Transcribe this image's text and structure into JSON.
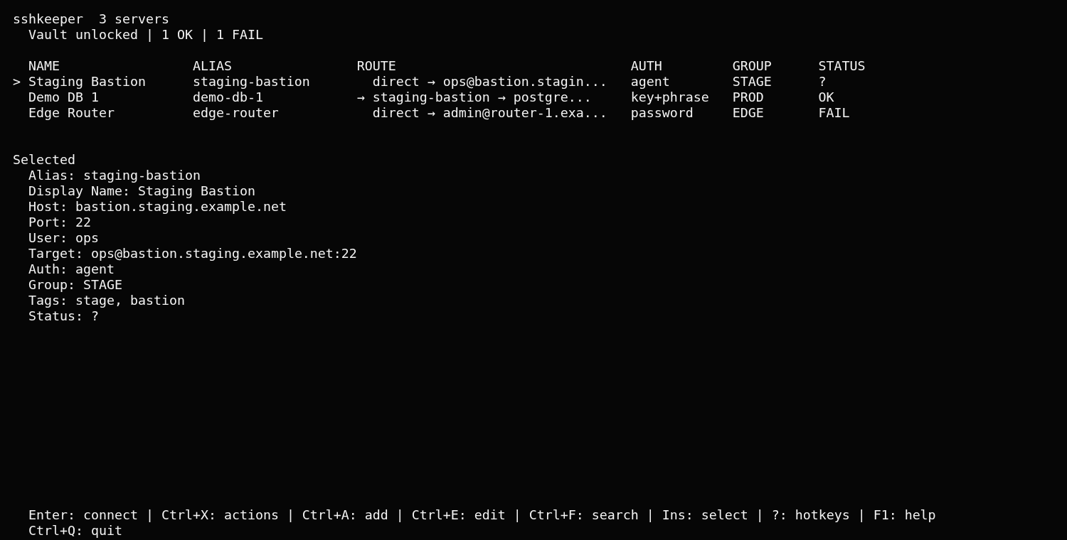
{
  "header": {
    "app_name": "sshkeeper",
    "server_count": "3 servers",
    "status_line": "Vault unlocked | 1 OK | 1 FAIL"
  },
  "table": {
    "cursor": ">",
    "columns": [
      "NAME",
      "ALIAS",
      "ROUTE",
      "AUTH",
      "GROUP",
      "STATUS"
    ],
    "rows": [
      {
        "selected": true,
        "name": "Staging Bastion",
        "alias": "staging-bastion",
        "route": "direct → ops@bastion.stagin...",
        "auth": "agent",
        "group": "STAGE",
        "status": "?"
      },
      {
        "selected": false,
        "name": "Demo DB 1",
        "alias": "demo-db-1",
        "jump_marker": "→",
        "route": "staging-bastion → postgre...",
        "auth": "key+phrase",
        "group": "PROD",
        "status": "OK"
      },
      {
        "selected": false,
        "name": "Edge Router",
        "alias": "edge-router",
        "route": "direct → admin@router-1.exa...",
        "auth": "password",
        "group": "EDGE",
        "status": "FAIL"
      }
    ]
  },
  "details": {
    "title": "Selected",
    "lines": [
      "Alias: staging-bastion",
      "Display Name: Staging Bastion",
      "Host: bastion.staging.example.net",
      "Port: 22",
      "User: ops",
      "Target: ops@bastion.staging.example.net:22",
      "Auth: agent",
      "Group: STAGE",
      "Tags: stage, bastion",
      "Status: ?"
    ]
  },
  "footer": {
    "lines": [
      "Enter: connect | Ctrl+X: actions | Ctrl+A: add | Ctrl+E: edit | Ctrl+F: search | Ins: select | ?: hotkeys | F1: help",
      "Ctrl+Q: quit"
    ]
  }
}
